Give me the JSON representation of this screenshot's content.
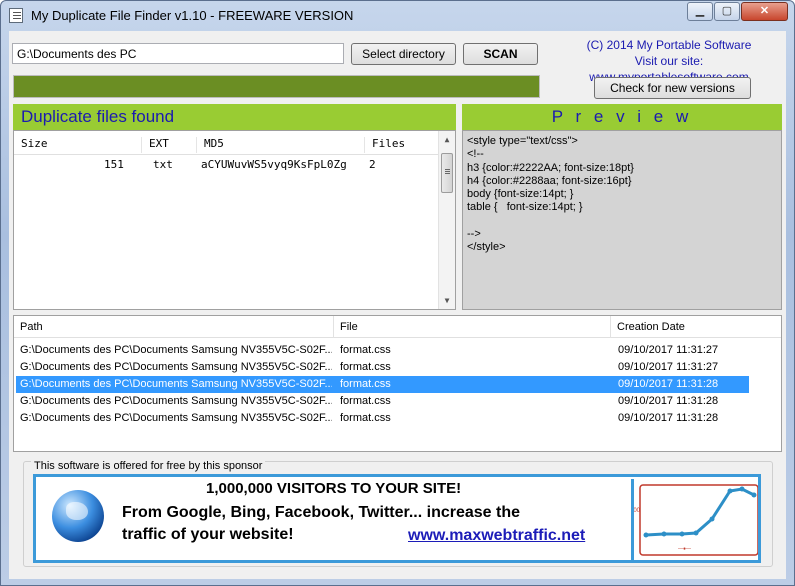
{
  "window": {
    "title": "My Duplicate File Finder v1.10 - FREEWARE VERSION",
    "controls": {
      "minimize": "▁",
      "maximize": "▢",
      "close": "✕"
    }
  },
  "toolbar": {
    "path_value": "G:\\Documents des PC",
    "select_label": "Select directory",
    "scan_label": "SCAN",
    "copyright": "(C) 2014 My Portable Software",
    "site": "Visit our site: www.myportablesoftware.com",
    "check_label": "Check for new versions",
    "progress": 1.0,
    "progress_color": "#6b8e23"
  },
  "duplicates": {
    "heading": "Duplicate files found",
    "columns": {
      "size": "Size",
      "ext": "EXT",
      "md5": "MD5",
      "files": "Files"
    },
    "rows": [
      {
        "size": "151",
        "ext": "txt",
        "md5": "aCYUWuvWS5vyq9KsFpL0Zg",
        "files": "2"
      }
    ]
  },
  "preview": {
    "heading": "P r e v i e w",
    "lines": [
      "<style type=\"text/css\">",
      "<!--",
      "h3 {color:#2222AA; font-size:18pt}",
      "h4 {color:#2288aa; font-size:16pt}",
      "body {font-size:14pt; }",
      "table {   font-size:14pt; }",
      "",
      "-->",
      "</style>"
    ]
  },
  "files_list": {
    "columns": {
      "path": "Path",
      "file": "File",
      "date": "Creation Date"
    },
    "selected_index": 2,
    "rows": [
      {
        "path": "G:\\Documents des PC\\Documents Samsung NV355V5C-S02F...",
        "file": "format.css",
        "date": "09/10/2017 11:31:27"
      },
      {
        "path": "G:\\Documents des PC\\Documents Samsung NV355V5C-S02F...",
        "file": "format.css",
        "date": "09/10/2017 11:31:27"
      },
      {
        "path": "G:\\Documents des PC\\Documents Samsung NV355V5C-S02F...",
        "file": "format.css",
        "date": "09/10/2017 11:31:28"
      },
      {
        "path": "G:\\Documents des PC\\Documents Samsung NV355V5C-S02F...",
        "file": "format.css",
        "date": "09/10/2017 11:31:28"
      },
      {
        "path": "G:\\Documents des PC\\Documents Samsung NV355V5C-S02F...",
        "file": "format.css",
        "date": "09/10/2017 11:31:28"
      }
    ]
  },
  "sponsor": {
    "label": "This software is offered for free by this sponsor",
    "headline": "1,000,000 VISITORS TO YOUR SITE!",
    "line2": "From Google, Bing, Facebook, Twitter... increase the",
    "line3": "traffic of your website!",
    "url": "www.maxwebtraffic.net"
  },
  "colors": {
    "accent_green": "#99cc33",
    "heading_blue": "#1b1bb0",
    "selection": "#3399ff",
    "ad_border": "#3c9ad9"
  }
}
